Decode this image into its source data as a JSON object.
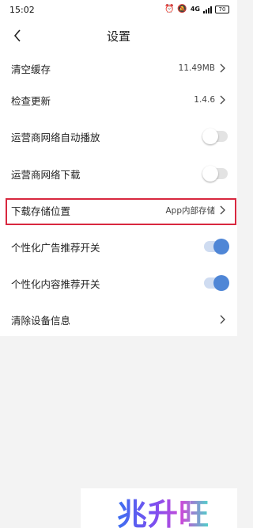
{
  "status_bar": {
    "time": "15:02",
    "alarm_icon": "alarm-icon",
    "mute_icon": "mute-icon",
    "network_label": "4G",
    "battery_level": "70"
  },
  "nav": {
    "title": "设置",
    "back_icon": "back-arrow-icon"
  },
  "settings": [
    {
      "label": "清空缓存",
      "value": "11.49MB",
      "control": "chevron"
    },
    {
      "label": "检查更新",
      "value": "1.4.6",
      "control": "chevron"
    },
    {
      "label": "运营商网络自动播放",
      "value": "",
      "control": "toggle",
      "state": "off"
    },
    {
      "label": "运营商网络下载",
      "value": "",
      "control": "toggle",
      "state": "off"
    },
    {
      "label": "下载存储位置",
      "value": "App内部存储",
      "control": "chevron",
      "highlighted": true
    },
    {
      "label": "个性化广告推荐开关",
      "value": "",
      "control": "toggle",
      "state": "on"
    },
    {
      "label": "个性化内容推荐开关",
      "value": "",
      "control": "toggle",
      "state": "on"
    },
    {
      "label": "清除设备信息",
      "value": "",
      "control": "chevron"
    }
  ],
  "colors": {
    "accent": "#4f86d6",
    "highlight_border": "#d8283f",
    "page_background": "#f3f3f3"
  },
  "watermark": {
    "text": "兆升旺"
  }
}
